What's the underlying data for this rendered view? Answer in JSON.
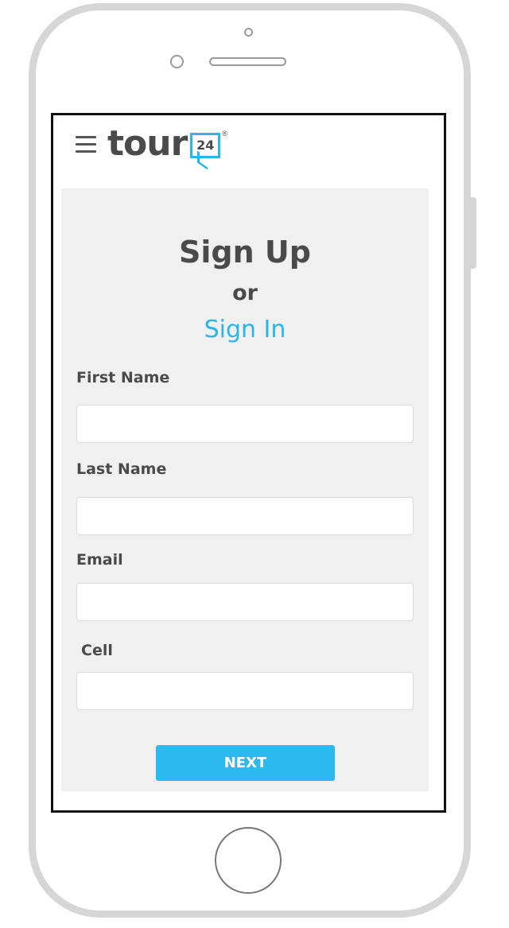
{
  "header": {
    "logo_text": "tour",
    "logo_badge": "24",
    "logo_registered": "®"
  },
  "form": {
    "title": "Sign Up",
    "or_text": "or",
    "signin_label": "Sign In",
    "fields": [
      {
        "label": "First Name",
        "value": "",
        "placeholder": ""
      },
      {
        "label": "Last Name",
        "value": "",
        "placeholder": ""
      },
      {
        "label": "Email",
        "value": "",
        "placeholder": ""
      },
      {
        "label": "Cell",
        "value": "",
        "placeholder": ""
      }
    ],
    "next_label": "NEXT"
  },
  "colors": {
    "accent": "#2cb5ea",
    "text": "#4a4a4a",
    "card_background": "#f0f0f0"
  }
}
